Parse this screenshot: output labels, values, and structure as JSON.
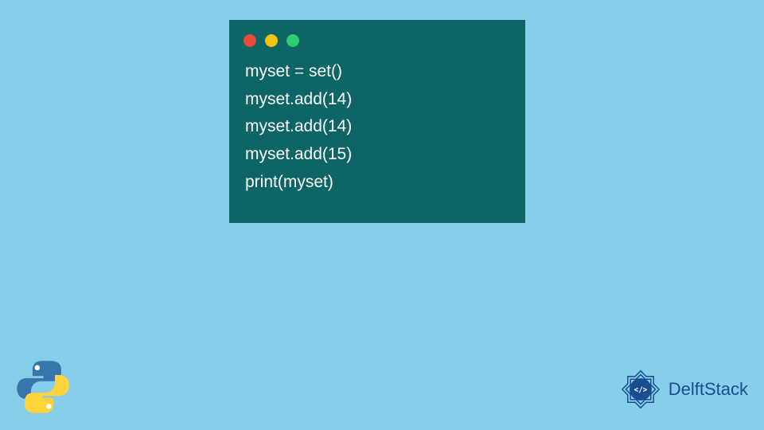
{
  "code": {
    "lines": [
      "myset = set()",
      "myset.add(14)",
      "myset.add(14)",
      "myset.add(15)",
      "print(myset)"
    ]
  },
  "window_controls": {
    "colors": [
      "#e74c3c",
      "#f1c40f",
      "#2ecc71"
    ]
  },
  "logos": {
    "python": "python-logo",
    "delftstack_text": "DelftStack"
  }
}
